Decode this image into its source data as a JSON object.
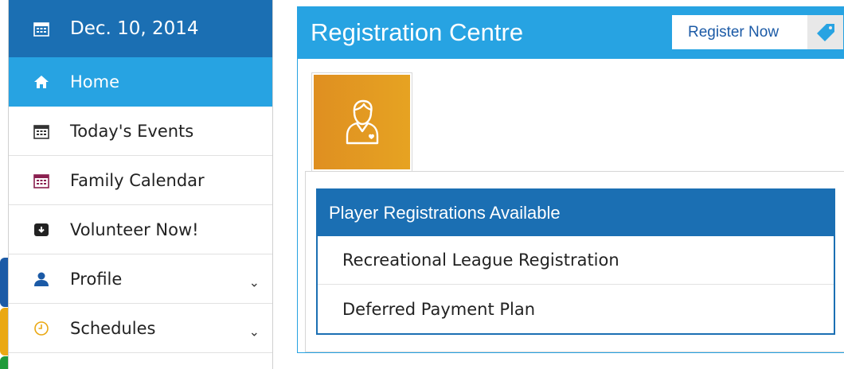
{
  "sidebar": {
    "date": "Dec. 10, 2014",
    "items": [
      {
        "label": "Home",
        "icon": "home-icon"
      },
      {
        "label": "Today's Events",
        "icon": "calendar-icon"
      },
      {
        "label": "Family Calendar",
        "icon": "calendar-icon"
      },
      {
        "label": "Volunteer Now!",
        "icon": "inbox-download-icon"
      },
      {
        "label": "Profile",
        "icon": "user-icon"
      },
      {
        "label": "Schedules",
        "icon": "clock-icon"
      }
    ]
  },
  "main": {
    "title": "Registration Centre",
    "register_button": "Register Now",
    "panel_title": "Player Registrations Available",
    "registrations": [
      "Recreational League Registration",
      "Deferred Payment Plan"
    ]
  },
  "colors": {
    "primary_dark": "#1b6fb3",
    "primary_light": "#27a3e2",
    "avatar_orange": "#e39a22",
    "edge_blue": "#1b5aa6",
    "edge_yellow": "#eaa813",
    "edge_green": "#1f9a3a"
  }
}
